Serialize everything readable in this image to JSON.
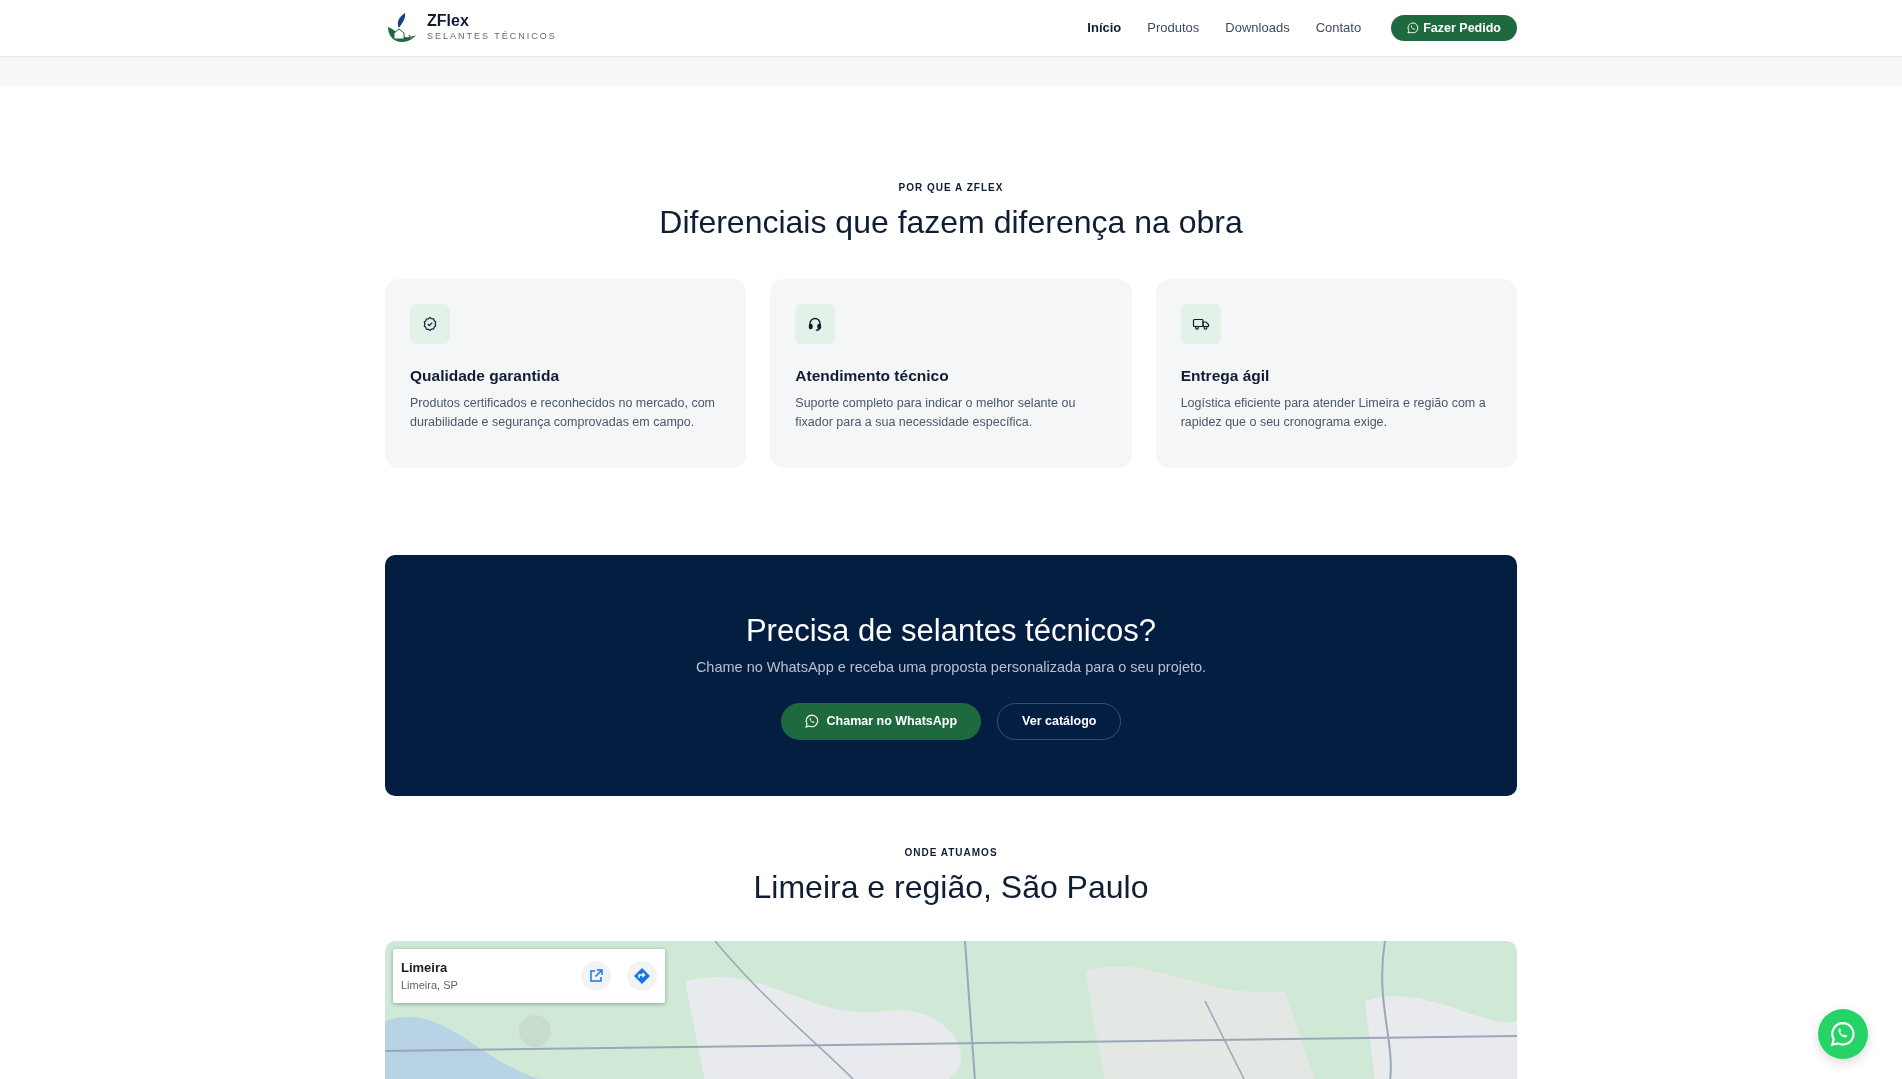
{
  "brand": {
    "name": "ZFlex",
    "tagline": "SELANTES TÉCNICOS"
  },
  "nav": [
    {
      "label": "Início",
      "selected": true
    },
    {
      "label": "Produtos",
      "selected": false
    },
    {
      "label": "Downloads",
      "selected": false
    },
    {
      "label": "Contato",
      "selected": false
    }
  ],
  "nav_button": "Fazer Pedido",
  "features": {
    "eyebrow": "POR QUE A ZFLEX",
    "title": "Diferenciais que fazem diferença na obra",
    "cards": [
      {
        "kind": "quality",
        "title": "Qualidade garantida",
        "text": "Produtos certificados e reconhecidos no mercado, com durabilidade e segurança comprovadas em campo."
      },
      {
        "kind": "support",
        "title": "Atendimento técnico",
        "text": "Suporte completo para indicar o melhor selante ou fixador para a sua necessidade específica."
      },
      {
        "kind": "delivery",
        "title": "Entrega ágil",
        "text": "Logística eficiente para atender Limeira e região com a rapidez que o seu cronograma exige."
      }
    ]
  },
  "cta": {
    "title": "Precisa de selantes técnicos?",
    "text": "Chame no WhatsApp e receba uma proposta personalizada para o seu projeto.",
    "primary": "Chamar no WhatsApp",
    "secondary": "Ver catálogo"
  },
  "location": {
    "eyebrow": "ONDE ATUAMOS",
    "title": "Limeira e região, São Paulo",
    "map": {
      "kind": "picture",
      "place": "Limeira",
      "address": "Limeira, SP"
    }
  }
}
